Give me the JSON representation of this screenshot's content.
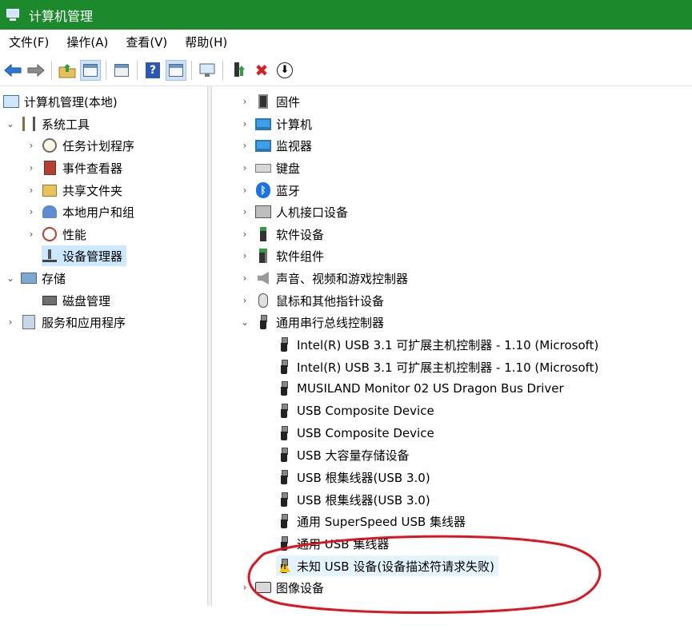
{
  "window": {
    "title": "计算机管理",
    "icon": "computer-management-icon"
  },
  "menu": [
    "文件(F)",
    "操作(A)",
    "查看(V)",
    "帮助(H)"
  ],
  "toolbar": {
    "buttons": [
      "back-arrow-icon",
      "forward-arrow-icon",
      "up-folder-icon",
      "show-hide-tree-icon",
      "properties-icon",
      "help-icon",
      "show-hide-action-pane-icon",
      "scan-hardware-icon",
      "enable-device-icon",
      "uninstall-device-icon",
      "update-driver-icon"
    ],
    "help_label": "?",
    "uninstall_glyph": "✖",
    "update_glyph": "⬇"
  },
  "tree": {
    "root": "计算机管理(本地)",
    "system_tools": "系统工具",
    "task_scheduler": "任务计划程序",
    "event_viewer": "事件查看器",
    "shared_folders": "共享文件夹",
    "local_users": "本地用户和组",
    "performance": "性能",
    "device_manager": "设备管理器",
    "storage": "存储",
    "disk_management": "磁盘管理",
    "services_apps": "服务和应用程序"
  },
  "devices": {
    "categories": [
      "固件",
      "计算机",
      "监视器",
      "键盘",
      "蓝牙",
      "人机接口设备",
      "软件设备",
      "软件组件",
      "声音、视频和游戏控制器",
      "鼠标和其他指针设备",
      "通用串行总线控制器"
    ],
    "usb_children": [
      "Intel(R) USB 3.1 可扩展主机控制器 - 1.10 (Microsoft)",
      "Intel(R) USB 3.1 可扩展主机控制器 - 1.10 (Microsoft)",
      "MUSILAND Monitor 02 US Dragon Bus Driver",
      "USB Composite Device",
      "USB Composite Device",
      "USB 大容量存储设备",
      "USB 根集线器(USB 3.0)",
      "USB 根集线器(USB 3.0)",
      "通用 SuperSpeed USB 集线器",
      "通用 USB 集线器",
      "未知 USB 设备(设备描述符请求失败)"
    ],
    "image_devices": "图像设备",
    "bluetooth_glyph": "ᛒ"
  },
  "annotation": {
    "color": "#e0141e"
  },
  "colors": {
    "title_bar": "#1c8a2c",
    "selection": "#cce8ff"
  }
}
